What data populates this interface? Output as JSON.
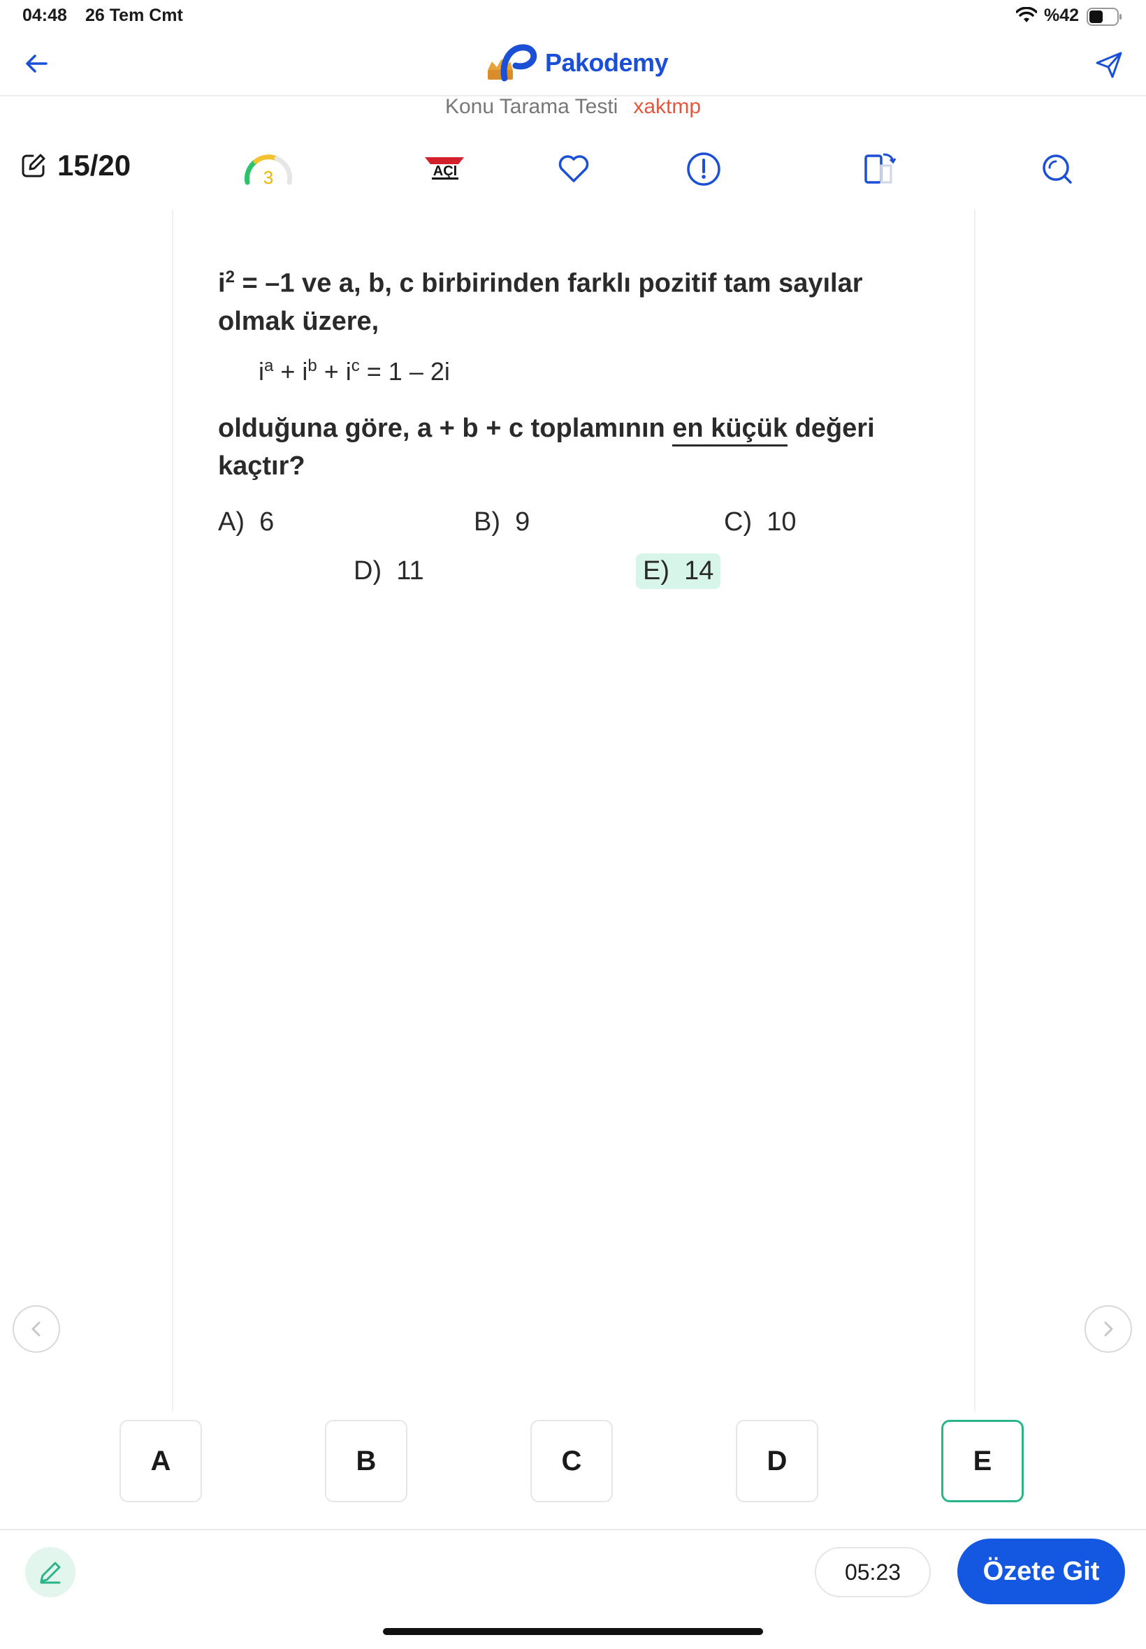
{
  "status_bar": {
    "time": "04:48",
    "date": "26 Tem Cmt",
    "battery": "%42"
  },
  "header": {
    "app_name": "Pakodemy",
    "test_name": "Konu Tarama Testi",
    "test_code": "xaktmp"
  },
  "toolbar": {
    "counter": "15/20",
    "gauge_value": "3",
    "publisher": "AÇI"
  },
  "question": {
    "intro_base": "i",
    "intro_exp": "2",
    "intro_rest": " = –1 ve a, b, c birbirinden farklı pozitif tam sayılar olmak üzere,",
    "formula": {
      "b1": "i",
      "e1": "a",
      "op1": " + ",
      "b2": "i",
      "e2": "b",
      "op2": " + ",
      "b3": "i",
      "e3": "c",
      "rhs": " = 1 – 2i"
    },
    "ask_pre": "olduğuna göre, a + b + c toplamının ",
    "ask_emph": "en küçük",
    "ask_post": " değeri kaçtır?",
    "options": [
      {
        "letter": "A)",
        "value": "6"
      },
      {
        "letter": "B)",
        "value": "9"
      },
      {
        "letter": "C)",
        "value": "10"
      },
      {
        "letter": "D)",
        "value": "11"
      },
      {
        "letter": "E)",
        "value": "14"
      }
    ]
  },
  "answers": [
    "A",
    "B",
    "C",
    "D",
    "E"
  ],
  "selected_answer": "E",
  "footer": {
    "timer": "05:23",
    "summary_label": "Özete Git"
  },
  "colors": {
    "primary": "#1457e0",
    "accent_green": "#2bb38a",
    "code_red": "#e2583e"
  }
}
